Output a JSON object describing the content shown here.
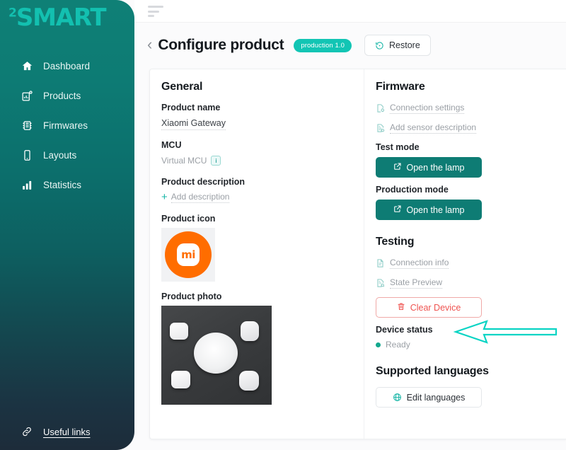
{
  "brand": {
    "logo_superscript": "2",
    "logo_text": "SMART"
  },
  "sidebar": {
    "items": [
      {
        "label": "Dashboard",
        "icon": "home-icon"
      },
      {
        "label": "Products",
        "icon": "products-icon"
      },
      {
        "label": "Firmwares",
        "icon": "chip-icon"
      },
      {
        "label": "Layouts",
        "icon": "mobile-icon"
      },
      {
        "label": "Statistics",
        "icon": "bar-chart-icon"
      }
    ],
    "footer_link": {
      "label": "Useful links",
      "icon": "link-icon"
    }
  },
  "topbar": {
    "menu_icon": "menu-icon"
  },
  "header": {
    "back_icon": "chevron-left-icon",
    "title": "Configure product",
    "version_badge": "production 1.0",
    "restore_label": "Restore",
    "restore_icon": "restore-icon"
  },
  "general": {
    "section_title": "General",
    "product_name_label": "Product name",
    "product_name_value": "Xiaomi Gateway",
    "mcu_label": "MCU",
    "mcu_value": "Virtual MCU",
    "mcu_badge_glyph": "i",
    "description_label": "Product description",
    "add_description_label": "Add description",
    "icon_label": "Product icon",
    "icon_mark_text": "mi",
    "photo_label": "Product photo"
  },
  "firmware": {
    "section_title": "Firmware",
    "connection_settings_label": "Connection settings",
    "connection_settings_icon": "document-settings-icon",
    "add_sensor_label": "Add sensor description",
    "add_sensor_icon": "document-add-icon",
    "test_mode_label": "Test mode",
    "test_mode_button": "Open the lamp",
    "production_mode_label": "Production mode",
    "production_mode_button": "Open the lamp",
    "open_icon": "external-link-icon"
  },
  "testing": {
    "section_title": "Testing",
    "connection_info_label": "Connection info",
    "connection_info_icon": "document-icon",
    "state_preview_label": "State Preview",
    "state_preview_icon": "document-preview-icon",
    "clear_device_label": "Clear Device",
    "clear_device_icon": "trash-icon",
    "device_status_label": "Device status",
    "device_status_value": "Ready"
  },
  "languages": {
    "section_title": "Supported languages",
    "edit_button": "Edit languages",
    "edit_icon": "globe-icon"
  },
  "annotation": {
    "arrow_icon": "left-arrow-annotation"
  },
  "colors": {
    "brand_teal": "#12c5b4",
    "sidebar_top": "#0f8076",
    "sidebar_bottom": "#1d2c3a",
    "button_teal": "#0e7c74",
    "danger": "#ef5350",
    "status_ready": "#14a88e",
    "mi_orange": "#ff6d00",
    "annotation": "#0ad4c4"
  }
}
